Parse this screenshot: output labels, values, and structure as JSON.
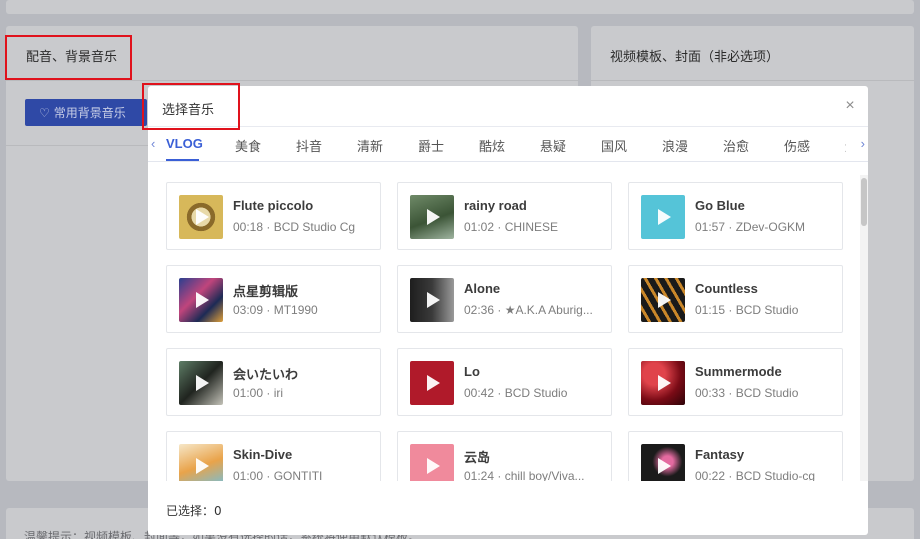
{
  "background": {
    "left_title": "配音、背景音乐",
    "right_title": "视频模板、封面（非必选项）",
    "fav_button": "常用背景音乐",
    "bottom_text": "温馨提示：视频模板、封面等，如果没有选择的话，系统将使用默认模板。"
  },
  "modal": {
    "title": "选择音乐",
    "close": "×",
    "selected_label": "已选择：0"
  },
  "tabs": [
    "VLOG",
    "美食",
    "抖音",
    "清新",
    "爵士",
    "酷炫",
    "悬疑",
    "国风",
    "浪漫",
    "治愈",
    "伤感",
    "运"
  ],
  "songs": [
    {
      "name": "Flute piccolo",
      "meta": "00:18 · BCD Studio Cg"
    },
    {
      "name": "rainy road",
      "meta": "01:02 · CHINESE"
    },
    {
      "name": "Go Blue",
      "meta": "01:57 · ZDev-OGKM"
    },
    {
      "name": "点星剪辑版",
      "meta": "03:09 · MT1990"
    },
    {
      "name": "Alone",
      "meta": "02:36 · ★A.K.A Aburig..."
    },
    {
      "name": "Countless",
      "meta": "01:15 · BCD Studio"
    },
    {
      "name": "会いたいわ",
      "meta": "01:00 · iri"
    },
    {
      "name": "Lo",
      "meta": "00:42 · BCD Studio"
    },
    {
      "name": "Summermode",
      "meta": "00:33 · BCD Studio"
    },
    {
      "name": "Skin-Dive",
      "meta": "01:00 · GONTITI"
    },
    {
      "name": "云岛",
      "meta": "01:24 · chill boy/Viva..."
    },
    {
      "name": "Fantasy",
      "meta": "00:22 · BCD Studio-cg"
    }
  ],
  "colors": {
    "accent": "#3a5fd6",
    "annotation_red": "#e0121c"
  }
}
